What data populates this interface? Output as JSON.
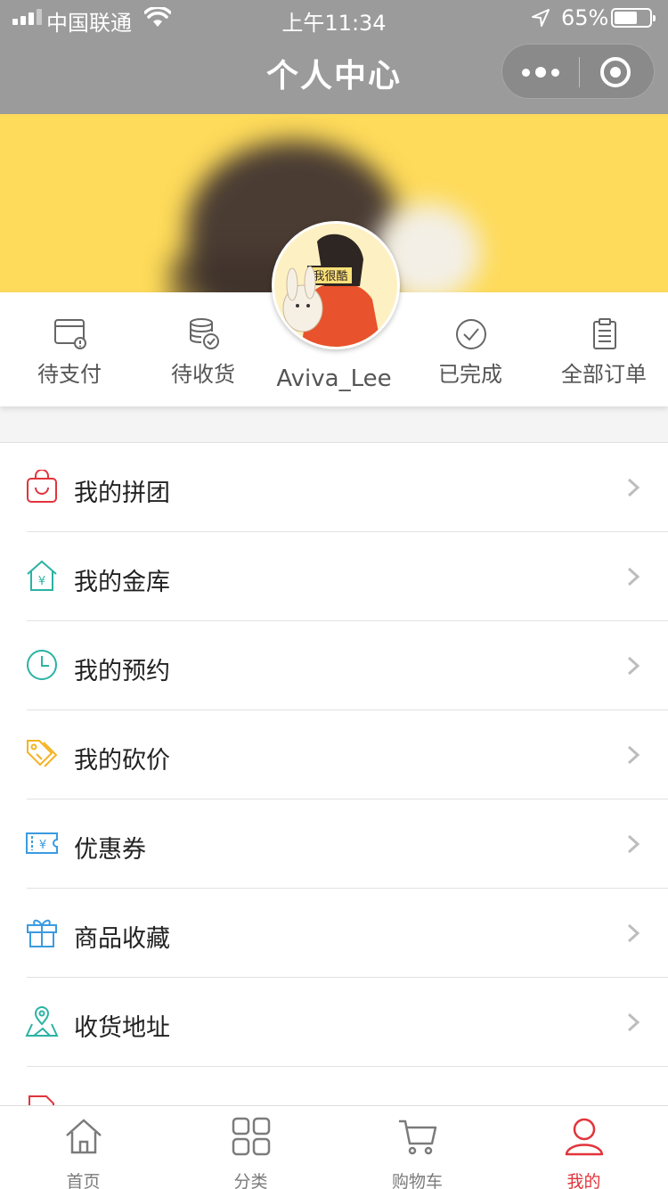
{
  "status_bar": {
    "carrier": "中国联通",
    "time": "上午11:34",
    "battery_percent": "65%",
    "battery_level": 0.65
  },
  "nav": {
    "title": "个人中心"
  },
  "profile": {
    "username": "Aviva_Lee"
  },
  "orders": [
    {
      "label": "待支付",
      "icon": "card-pending-icon"
    },
    {
      "label": "待收货",
      "icon": "database-check-icon"
    },
    {
      "label": "已完成",
      "icon": "check-circle-icon"
    },
    {
      "label": "全部订单",
      "icon": "clipboard-icon"
    }
  ],
  "menu": [
    {
      "label": "我的拼团",
      "icon": "shopping-bag-icon",
      "color": "#e2343c"
    },
    {
      "label": "我的金库",
      "icon": "house-yen-icon",
      "color": "#2bb3a3"
    },
    {
      "label": "我的预约",
      "icon": "clock-icon",
      "color": "#2bb3a3"
    },
    {
      "label": "我的砍价",
      "icon": "tag-icon",
      "color": "#f5b323"
    },
    {
      "label": "优惠券",
      "icon": "coupon-icon",
      "color": "#3a9be0"
    },
    {
      "label": "商品收藏",
      "icon": "gift-icon",
      "color": "#3a9be0"
    },
    {
      "label": "收货地址",
      "icon": "map-pin-icon",
      "color": "#2bb3a3"
    }
  ],
  "tabs": [
    {
      "label": "首页",
      "icon": "home-icon",
      "active": false
    },
    {
      "label": "分类",
      "icon": "grid-icon",
      "active": false
    },
    {
      "label": "购物车",
      "icon": "cart-icon",
      "active": false
    },
    {
      "label": "我的",
      "icon": "user-icon",
      "active": true
    }
  ],
  "colors": {
    "header_bg": "#9b9b9b",
    "banner_bg": "#fedb5a",
    "accent": "#e2343c"
  }
}
